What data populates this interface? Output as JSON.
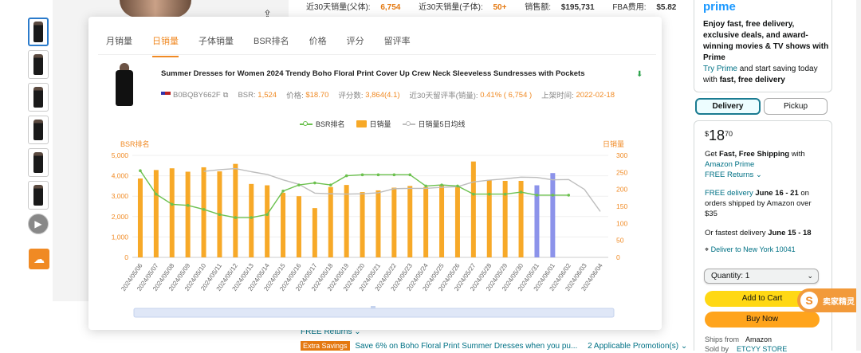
{
  "background_page": {
    "stats_row": [
      {
        "label": "近30天销量(父体):",
        "value": "6,754"
      },
      {
        "label": "近30天销量(子体):",
        "value": "50+"
      },
      {
        "label": "销售额:",
        "value": "$195,731"
      },
      {
        "label": "FBA费用:",
        "value": "$5.82"
      }
    ],
    "free_returns": "FREE Returns ⌄",
    "extra_savings_badge": "Extra Savings",
    "extra_savings_text": "Save 6% on Boho Floral Print Summer Dresses when you pu...",
    "applicable_promotions": "2 Applicable Promotion(s) ⌄"
  },
  "buybox": {
    "prime_logo": "prime",
    "prime_line1": "Enjoy fast, free delivery, exclusive deals, and award-winning movies & TV shows with Prime",
    "try_prime": "Try Prime",
    "prime_line2_a": " and start saving today with ",
    "prime_line2_b": "fast, free delivery",
    "tab_delivery": "Delivery",
    "tab_pickup": "Pickup",
    "price_symbol": "$",
    "price_whole": "18",
    "price_fraction": "70",
    "get_fast": "Get ",
    "fast_free": "Fast, Free Shipping",
    "with": " with",
    "amazon_prime": "Amazon Prime",
    "free_returns": "FREE Returns ⌄",
    "free_delivery_a": "FREE delivery ",
    "free_delivery_dates": "June 16 - 21",
    "free_delivery_b": " on orders shipped by Amazon over $35",
    "fastest_a": "Or fastest delivery ",
    "fastest_dates": "June 15 - 18",
    "deliver_to": "Deliver to New York 10041",
    "quantity": "Quantity: 1",
    "add_to_cart": "Add to Cart",
    "buy_now": "Buy Now",
    "ships_from_label": "Ships from",
    "ships_from_value": "Amazon",
    "sold_by_label": "Sold by",
    "sold_by_value": "ETCYY STORE"
  },
  "plugin_badge": "卖家精灵",
  "modal": {
    "tabs": [
      "月销量",
      "日销量",
      "子体销量",
      "BSR排名",
      "价格",
      "评分",
      "留评率"
    ],
    "active_tab": 1,
    "product_title": "Summer Dresses for Women 2024 Trendy Boho Floral Print Cover Up Crew Neck Sleeveless Sundresses with Pockets",
    "asin": "B0BQBY662F",
    "bsr_label": "BSR:",
    "bsr_value": "1,524",
    "price_label": "价格:",
    "price_value": "$18.70",
    "rating_label": "评分数:",
    "rating_value": "3,864(4.1)",
    "review_rate_label": "近30天留评率(销量):",
    "review_rate_value": "0.41% ( 6,754 )",
    "listed_label": "上架时间:",
    "listed_value": "2022-02-18"
  },
  "colors": {
    "accent": "#f08a24",
    "bar": "#f7a928",
    "bar_highlight": "#8c93ea",
    "bsr_line": "#6cc14f",
    "ma_line": "#bdbdbd"
  },
  "chart_data": {
    "type": "bar",
    "legend": [
      "BSR排名",
      "日销量",
      "日销量5日均线"
    ],
    "left_axis_label": "BSR排名",
    "right_axis_label": "日销量",
    "left_ticks": [
      "5,000",
      "4,000",
      "3,000",
      "2,000",
      "1,000",
      "0"
    ],
    "right_ticks": [
      "300",
      "250",
      "200",
      "150",
      "100",
      "50",
      "0"
    ],
    "left_ylim": [
      0,
      5000
    ],
    "right_ylim": [
      0,
      300
    ],
    "categories": [
      "2024/05/06",
      "2024/05/07",
      "2024/05/08",
      "2024/05/09",
      "2024/05/10",
      "2024/05/11",
      "2024/05/12",
      "2024/05/13",
      "2024/05/14",
      "2024/05/15",
      "2024/05/16",
      "2024/05/17",
      "2024/05/18",
      "2024/05/19",
      "2024/05/20",
      "2024/05/21",
      "2024/05/22",
      "2024/05/23",
      "2024/05/24",
      "2024/05/25",
      "2024/05/26",
      "2024/05/27",
      "2024/05/28",
      "2024/05/29",
      "2024/05/30",
      "2024/05/31",
      "2024/06/01",
      "2024/06/02",
      "2024/06/03",
      "2024/06/04"
    ],
    "series": [
      {
        "name": "日销量",
        "axis": "right",
        "values": [
          232,
          257,
          262,
          252,
          265,
          253,
          275,
          216,
          212,
          190,
          180,
          145,
          207,
          213,
          192,
          197,
          205,
          210,
          207,
          212,
          208,
          282,
          228,
          225,
          225,
          212,
          248,
          null,
          null,
          null
        ],
        "highlight": [
          false,
          false,
          false,
          false,
          false,
          false,
          false,
          false,
          false,
          false,
          false,
          false,
          false,
          false,
          false,
          false,
          false,
          false,
          false,
          false,
          false,
          false,
          false,
          false,
          false,
          true,
          true,
          false,
          false,
          false
        ]
      },
      {
        "name": "BSR排名",
        "axis": "left",
        "values": [
          4250,
          3100,
          2600,
          2550,
          2350,
          2100,
          1950,
          1950,
          2100,
          3250,
          3550,
          3650,
          3550,
          4000,
          4050,
          4050,
          4050,
          4050,
          3500,
          3550,
          3500,
          3100,
          3100,
          3100,
          3200,
          3050,
          3050,
          3050,
          null,
          null
        ]
      },
      {
        "name": "日销量5日均线",
        "axis": "right",
        "values": [
          null,
          null,
          null,
          null,
          253,
          258,
          261,
          252,
          244,
          228,
          215,
          189,
          187,
          186,
          187,
          190,
          202,
          203,
          203,
          206,
          208,
          222,
          227,
          231,
          236,
          235,
          228,
          229,
          200,
          135
        ]
      }
    ]
  }
}
